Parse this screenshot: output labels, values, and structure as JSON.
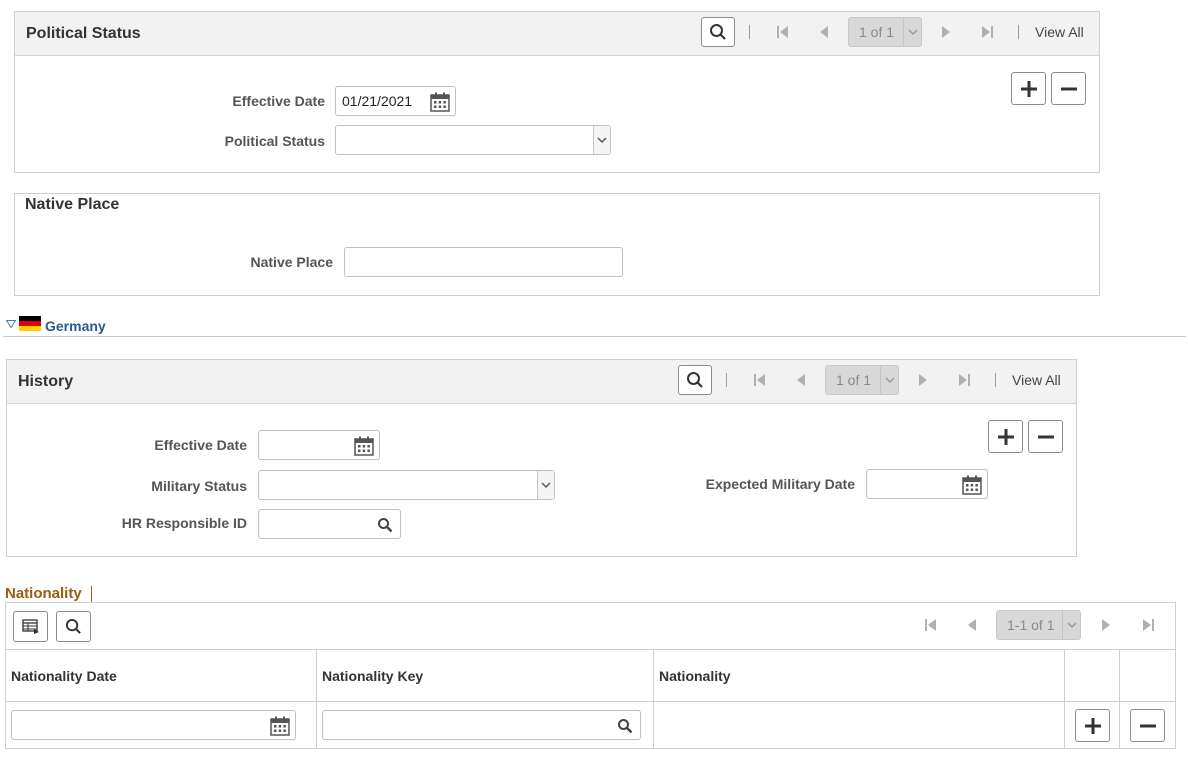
{
  "political_status": {
    "title": "Political Status",
    "nav": {
      "page": "1 of 1",
      "view_all": "View All"
    },
    "effective_date_label": "Effective Date",
    "effective_date_value": "01/21/2021",
    "political_status_label": "Political Status",
    "political_status_value": ""
  },
  "native_place": {
    "title": "Native Place",
    "native_place_label": "Native Place",
    "native_place_value": ""
  },
  "germany": {
    "label": "Germany",
    "flag_colors": [
      "#000000",
      "#dd0000",
      "#ffce00"
    ]
  },
  "history": {
    "title": "History",
    "nav": {
      "page": "1 of 1",
      "view_all": "View All"
    },
    "effective_date_label": "Effective Date",
    "effective_date_value": "",
    "military_status_label": "Military Status",
    "military_status_value": "",
    "expected_military_date_label": "Expected Military Date",
    "expected_military_date_value": "",
    "hr_responsible_label": "HR Responsible ID",
    "hr_responsible_value": ""
  },
  "nationality": {
    "title": "Nationality",
    "page": "1-1 of 1",
    "columns": [
      "Nationality Date",
      "Nationality Key",
      "Nationality"
    ],
    "rows": [
      {
        "nationality_date": "",
        "nationality_key": "",
        "nationality": ""
      }
    ]
  },
  "colors": {
    "header_bg": "#f2f2f2",
    "section_title_accent": "#9a5b13",
    "link_blue": "#2a5a8c"
  }
}
